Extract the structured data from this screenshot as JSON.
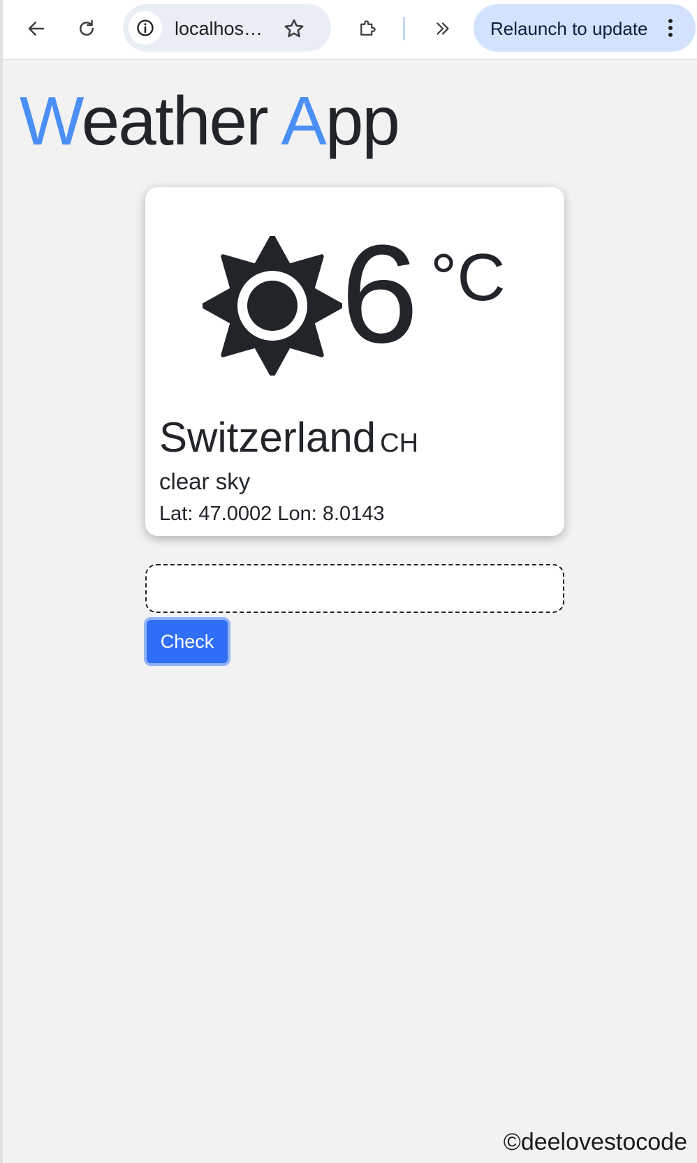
{
  "browser": {
    "url": "localhos…",
    "relaunch_label": "Relaunch to update",
    "icons": [
      "back-arrow-icon",
      "reload-icon",
      "info-icon",
      "star-icon",
      "extensions-icon",
      "chevron-double-right-icon",
      "kebab-menu-icon"
    ]
  },
  "app": {
    "title_first_letter": "W",
    "title_first_rest": "eather ",
    "title_second_letter": "A",
    "title_second_rest": "pp",
    "accent_color": "#4a8ff5"
  },
  "weather": {
    "icon": "sun-icon",
    "temperature": "6",
    "unit": "°C",
    "country": "Switzerland",
    "country_code": "CH",
    "description": "clear sky",
    "coordinates": "Lat: 47.0002 Lon: 8.0143"
  },
  "form": {
    "input_value": "",
    "check_label": "Check",
    "button_color": "#2f6ef5"
  },
  "footer": {
    "credit": "©deelovestocode"
  }
}
